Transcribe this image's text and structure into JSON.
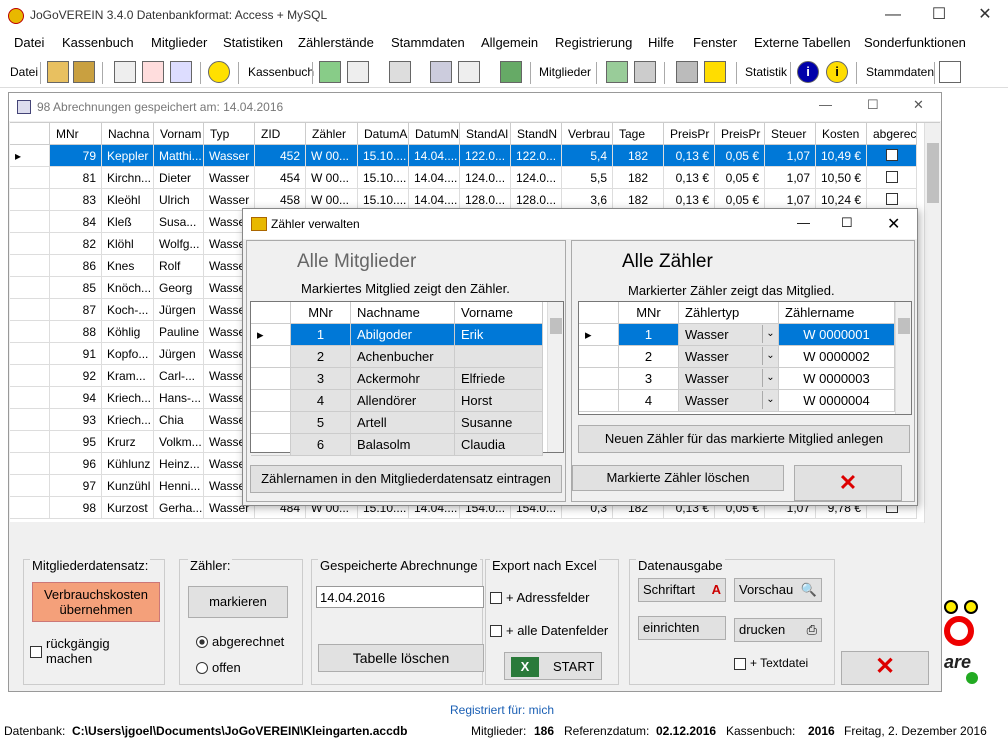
{
  "window": {
    "title": "JoGoVEREIN 3.4.0 Datenbankformat: Access + MySQL"
  },
  "menu": [
    "Datei",
    "Kassenbuch",
    "Mitglieder",
    "Statistiken",
    "Zählerstände",
    "Stammdaten",
    "Allgemein",
    "Registrierung",
    "Hilfe",
    "Fenster",
    "Externe Tabellen",
    "Sonderfunktionen"
  ],
  "toolbar": {
    "datei": "Datei",
    "kassenbuch": "Kassenbuch",
    "mitglieder": "Mitglieder",
    "statistik": "Statistik",
    "stammdaten": "Stammdaten"
  },
  "inner": {
    "title": "98 Abrechnungen gespeichert am: 14.04.2016"
  },
  "grid": {
    "headers": [
      "MNr",
      "Nachna",
      "Vornam",
      "Typ",
      "ZID",
      "Zähler",
      "DatumA",
      "DatumN",
      "StandAl",
      "StandN",
      "Verbrau",
      "Tage",
      "PreisPr",
      "PreisPr",
      "Steuer",
      "Kosten",
      "abgerec"
    ],
    "rows": [
      [
        "79",
        "Keppler",
        "Matthi...",
        "Wasser",
        "452",
        "W 00...",
        "15.10....",
        "14.04....",
        "122.0...",
        "122.0...",
        "5,4",
        "182",
        "0,13 €",
        "0,05 €",
        "1,07",
        "10,49 €"
      ],
      [
        "81",
        "Kirchn...",
        "Dieter",
        "Wasser",
        "454",
        "W 00...",
        "15.10....",
        "14.04....",
        "124.0...",
        "124.0...",
        "5,5",
        "182",
        "0,13 €",
        "0,05 €",
        "1,07",
        "10,50 €"
      ],
      [
        "83",
        "Kleöhl",
        "Ulrich",
        "Wasser",
        "458",
        "W 00...",
        "15.10....",
        "14.04....",
        "128.0...",
        "128.0...",
        "3,6",
        "182",
        "0,13 €",
        "0,05 €",
        "1,07",
        "10,24 €"
      ],
      [
        "84",
        "Kleß",
        "Susa...",
        "Wasser",
        "",
        "",
        "",
        "",
        "",
        "",
        "",
        "",
        "",
        "",
        "",
        ""
      ],
      [
        "82",
        "Klöhl",
        "Wolfg...",
        "Wasser",
        "",
        "",
        "",
        "",
        "",
        "",
        "",
        "",
        "",
        "",
        "",
        ""
      ],
      [
        "86",
        "Knes",
        "Rolf",
        "Wasser",
        "",
        "",
        "",
        "",
        "",
        "",
        "",
        "",
        "",
        "",
        "",
        ""
      ],
      [
        "85",
        "Knöch...",
        "Georg",
        "Wasser",
        "",
        "",
        "",
        "",
        "",
        "",
        "",
        "",
        "",
        "",
        "",
        ""
      ],
      [
        "87",
        "Koch-...",
        "Jürgen",
        "Wasser",
        "",
        "",
        "",
        "",
        "",
        "",
        "",
        "",
        "",
        "",
        "",
        ""
      ],
      [
        "88",
        "Köhlig",
        "Pauline",
        "Wasser",
        "",
        "",
        "",
        "",
        "",
        "",
        "",
        "",
        "",
        "",
        "",
        ""
      ],
      [
        "91",
        "Kopfo...",
        "Jürgen",
        "Wasser",
        "",
        "",
        "",
        "",
        "",
        "",
        "",
        "",
        "",
        "",
        "",
        ""
      ],
      [
        "92",
        "Kram...",
        "Carl-...",
        "Wasser",
        "",
        "",
        "",
        "",
        "",
        "",
        "",
        "",
        "",
        "",
        "",
        ""
      ],
      [
        "94",
        "Kriech...",
        "Hans-...",
        "Wasser",
        "",
        "",
        "",
        "",
        "",
        "",
        "",
        "",
        "",
        "",
        "",
        ""
      ],
      [
        "93",
        "Kriech...",
        "Chia",
        "Wasser",
        "",
        "",
        "",
        "",
        "",
        "",
        "",
        "",
        "",
        "",
        "",
        ""
      ],
      [
        "95",
        "Krurz",
        "Volkm...",
        "Wasser",
        "",
        "",
        "",
        "",
        "",
        "",
        "",
        "",
        "",
        "",
        "",
        ""
      ],
      [
        "96",
        "Kühlunz",
        "Heinz...",
        "Wasser",
        "",
        "",
        "",
        "",
        "",
        "",
        "",
        "",
        "",
        "",
        "",
        ""
      ],
      [
        "97",
        "Kunzühl",
        "Henni...",
        "Wasser",
        "",
        "",
        "",
        "",
        "",
        "",
        "",
        "",
        "",
        "",
        "",
        ""
      ],
      [
        "98",
        "Kurzost",
        "Gerha...",
        "Wasser",
        "484",
        "W 00...",
        "15.10....",
        "14.04....",
        "154.0...",
        "154.0...",
        "0,3",
        "182",
        "0,13 €",
        "0,05 €",
        "1,07",
        "9,78 €"
      ]
    ]
  },
  "dialog": {
    "title": "Zähler verwalten",
    "left": {
      "heading": "Alle Mitglieder",
      "sub": "Markiertes Mitglied zeigt den Zähler.",
      "headers": [
        "MNr",
        "Nachname",
        "Vorname"
      ],
      "rows": [
        [
          "1",
          "Abilgoder",
          "Erik"
        ],
        [
          "2",
          "Achenbucher",
          ""
        ],
        [
          "3",
          "Ackermohr",
          "Elfriede"
        ],
        [
          "4",
          "Allendörer",
          "Horst"
        ],
        [
          "5",
          "Artell",
          "Susanne"
        ],
        [
          "6",
          "Balasolm",
          "Claudia"
        ]
      ],
      "button": "Zählernamen in den Mitgliederdatensatz eintragen"
    },
    "right": {
      "heading": "Alle Zähler",
      "sub": "Markierter Zähler zeigt das Mitglied.",
      "headers": [
        "MNr",
        "Zählertyp",
        "Zählername"
      ],
      "rows": [
        [
          "1",
          "Wasser",
          "W 0000001"
        ],
        [
          "2",
          "Wasser",
          "W 0000002"
        ],
        [
          "3",
          "Wasser",
          "W 0000003"
        ],
        [
          "4",
          "Wasser",
          "W 0000004"
        ]
      ],
      "new_button": "Neuen Zähler für das markierte Mitglied anlegen",
      "delete_button": "Markierte Zähler löschen"
    }
  },
  "bottom": {
    "g1": {
      "label": "Mitgliederdatensatz:",
      "btn": "Verbrauchskosten übernehmen",
      "undo": "rückgängig machen"
    },
    "g2": {
      "label": "Zähler:",
      "btn": "markieren",
      "r1": "abgerechnet",
      "r2": "offen"
    },
    "g3": {
      "label": "Gespeicherte Abrechnunge",
      "date": "14.04.2016",
      "btn": "Tabelle löschen"
    },
    "g4": {
      "label": "Export nach Excel",
      "c1": "+ Adressfelder",
      "c2": "+ alle Datenfelder",
      "start": "START"
    },
    "g5": {
      "label": "Datenausgabe",
      "schrift": "Schriftart",
      "vorschau": "Vorschau",
      "einrichten": "einrichten",
      "drucken": "drucken",
      "txt": "+ Textdatei"
    }
  },
  "registered": "Registriert für: mich",
  "status": {
    "db_label": "Datenbank:",
    "db_path": "C:\\Users\\jgoel\\Documents\\JoGoVEREIN\\Kleingarten.accdb",
    "mit_label": "Mitglieder:",
    "mit": "186",
    "ref_label": "Referenzdatum:",
    "ref": "02.12.2016",
    "kb_label": "Kassenbuch:",
    "kb": "2016",
    "date": "Freitag, 2. Dezember 2016"
  },
  "logo_text": "are"
}
